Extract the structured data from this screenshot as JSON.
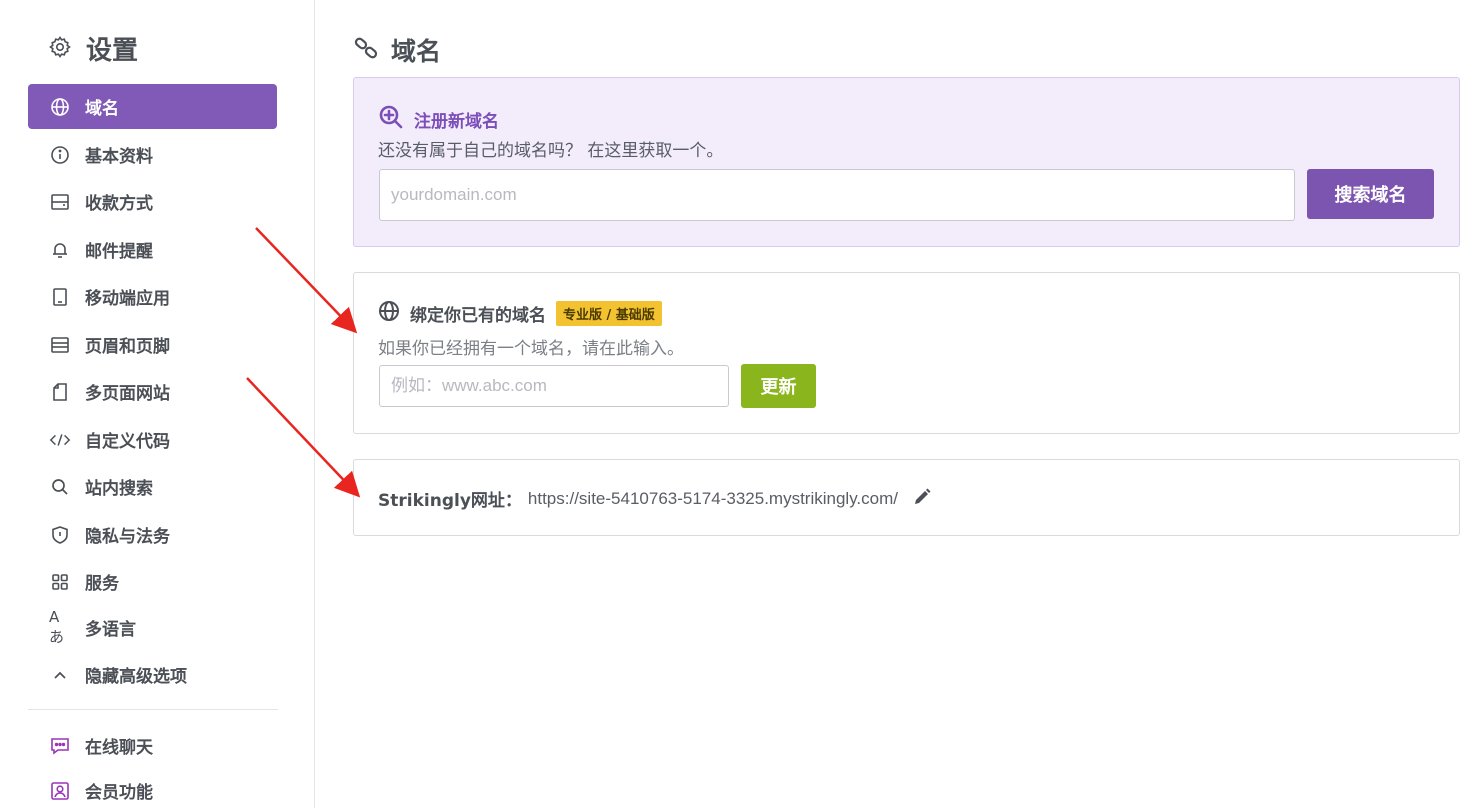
{
  "sidebar": {
    "title": "设置",
    "items": [
      {
        "label": "域名",
        "icon": "globe-icon"
      },
      {
        "label": "基本资料",
        "icon": "info-icon"
      },
      {
        "label": "收款方式",
        "icon": "wallet-icon"
      },
      {
        "label": "邮件提醒",
        "icon": "bell-icon"
      },
      {
        "label": "移动端应用",
        "icon": "tablet-icon"
      },
      {
        "label": "页眉和页脚",
        "icon": "layout-icon"
      },
      {
        "label": "多页面网站",
        "icon": "pages-icon"
      },
      {
        "label": "自定义代码",
        "icon": "code-icon"
      },
      {
        "label": "站内搜索",
        "icon": "search-icon"
      },
      {
        "label": "隐私与法务",
        "icon": "shield-icon"
      },
      {
        "label": "服务",
        "icon": "grid-icon"
      },
      {
        "label": "多语言",
        "icon": "language-icon"
      },
      {
        "label": "隐藏高级选项",
        "icon": "chevron-up-icon"
      }
    ],
    "extra": [
      {
        "label": "在线聊天",
        "icon": "chat-icon"
      },
      {
        "label": "会员功能",
        "icon": "member-icon"
      }
    ]
  },
  "main": {
    "title": "域名",
    "register": {
      "heading": "注册新域名",
      "desc": "还没有属于自己的域名吗？ 在这里获取一个。",
      "placeholder": "yourdomain.com",
      "button": "搜索域名"
    },
    "bind": {
      "heading": "绑定你已有的域名",
      "badge": "专业版 / 基础版",
      "desc": "如果你已经拥有一个域名，请在此输入。",
      "placeholder": "例如：www.abc.com",
      "button": "更新"
    },
    "strikingly": {
      "label": "Strikingly网址：",
      "url": "https://site-5410763-5174-3325.mystrikingly.com/"
    }
  },
  "colors": {
    "accent": "#8159b6",
    "update_button": "#8ab51c",
    "badge": "#f2c230",
    "annotation_arrow": "#e8261f"
  }
}
